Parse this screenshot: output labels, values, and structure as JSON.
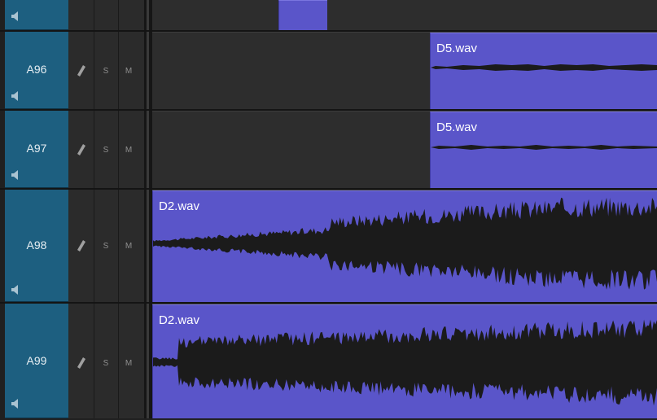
{
  "tracks": [
    {
      "id": "top",
      "name": ""
    },
    {
      "id": "a96",
      "name": "A96",
      "clip_label": "D5.wav"
    },
    {
      "id": "a97",
      "name": "A97",
      "clip_label": "D5.wav"
    },
    {
      "id": "a98",
      "name": "A98",
      "clip_label": "D2.wav"
    },
    {
      "id": "a99",
      "name": "A99",
      "clip_label": "D2.wav"
    }
  ],
  "controls": {
    "solo_label": "S",
    "mute_label": "M"
  },
  "icons": {
    "speaker": "speaker-icon",
    "record": "pencil-icon"
  },
  "colors": {
    "header": "#1d5f80",
    "clip": "#5a55c9",
    "waveform": "#1b1b1b",
    "lane": "#2d2d2d"
  }
}
